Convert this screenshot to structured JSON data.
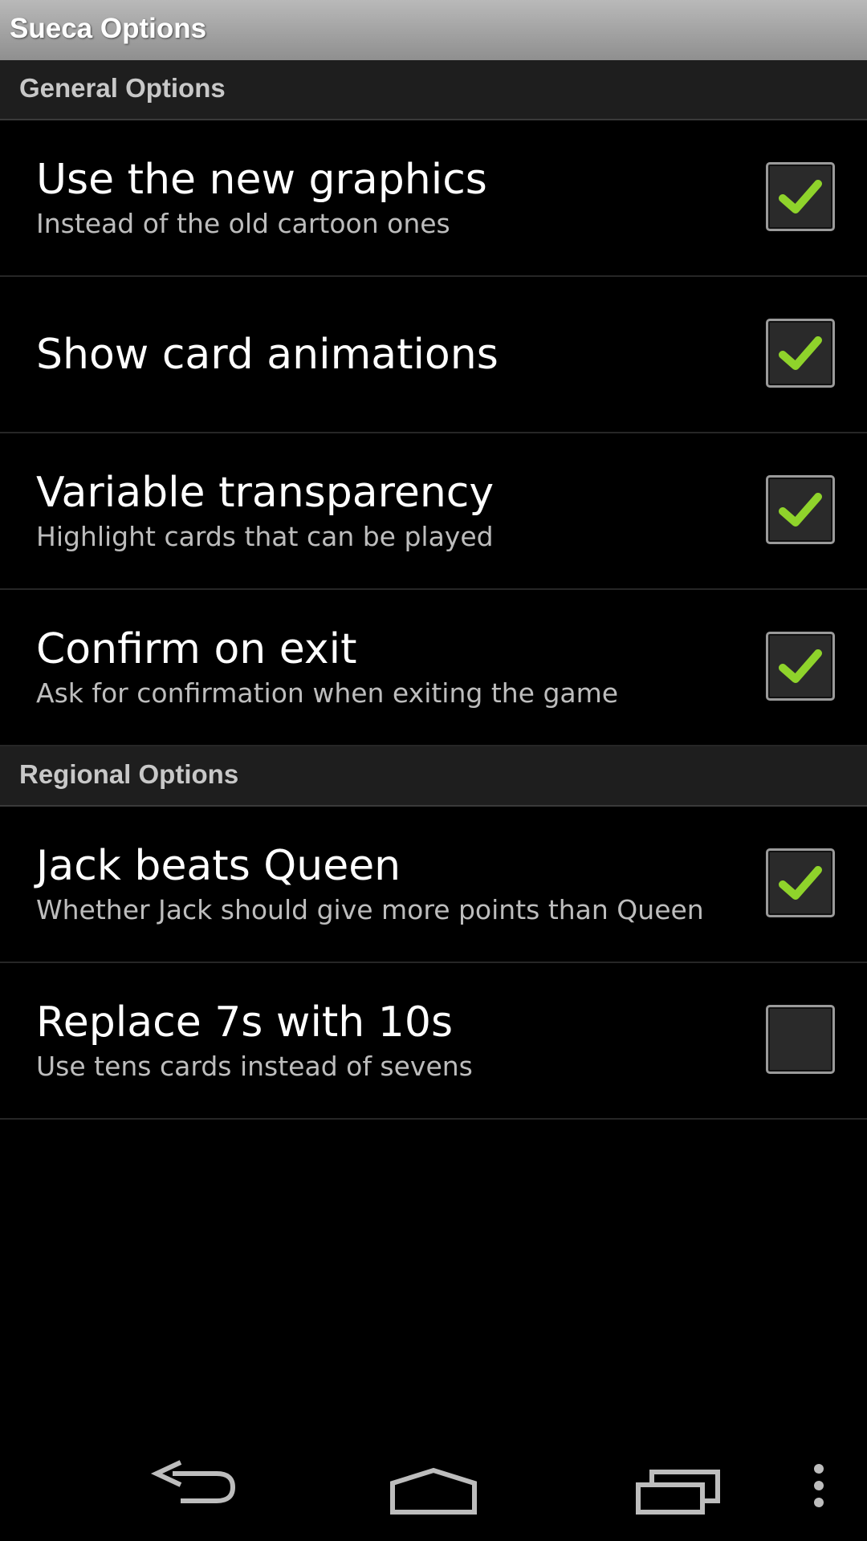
{
  "header": {
    "title": "Sueca Options"
  },
  "sections": [
    {
      "title": "General Options",
      "items": [
        {
          "title": "Use the new graphics",
          "summary": "Instead of the old cartoon ones",
          "checked": true
        },
        {
          "title": "Show card animations",
          "summary": "",
          "checked": true
        },
        {
          "title": "Variable transparency",
          "summary": "Highlight cards that can be played",
          "checked": true
        },
        {
          "title": "Confirm on exit",
          "summary": "Ask for confirmation when exiting the game",
          "checked": true
        }
      ]
    },
    {
      "title": "Regional Options",
      "items": [
        {
          "title": "Jack beats Queen",
          "summary": "Whether Jack should give more points than Queen",
          "checked": true
        },
        {
          "title": "Replace 7s with 10s",
          "summary": "Use tens cards instead of sevens",
          "checked": false
        }
      ]
    }
  ],
  "navbar": {
    "icons": [
      "back-icon",
      "home-icon",
      "recent-apps-icon",
      "overflow-menu-icon"
    ]
  },
  "colors": {
    "check_accent": "#8fd32b",
    "section_bg": "#1e1e1e"
  }
}
